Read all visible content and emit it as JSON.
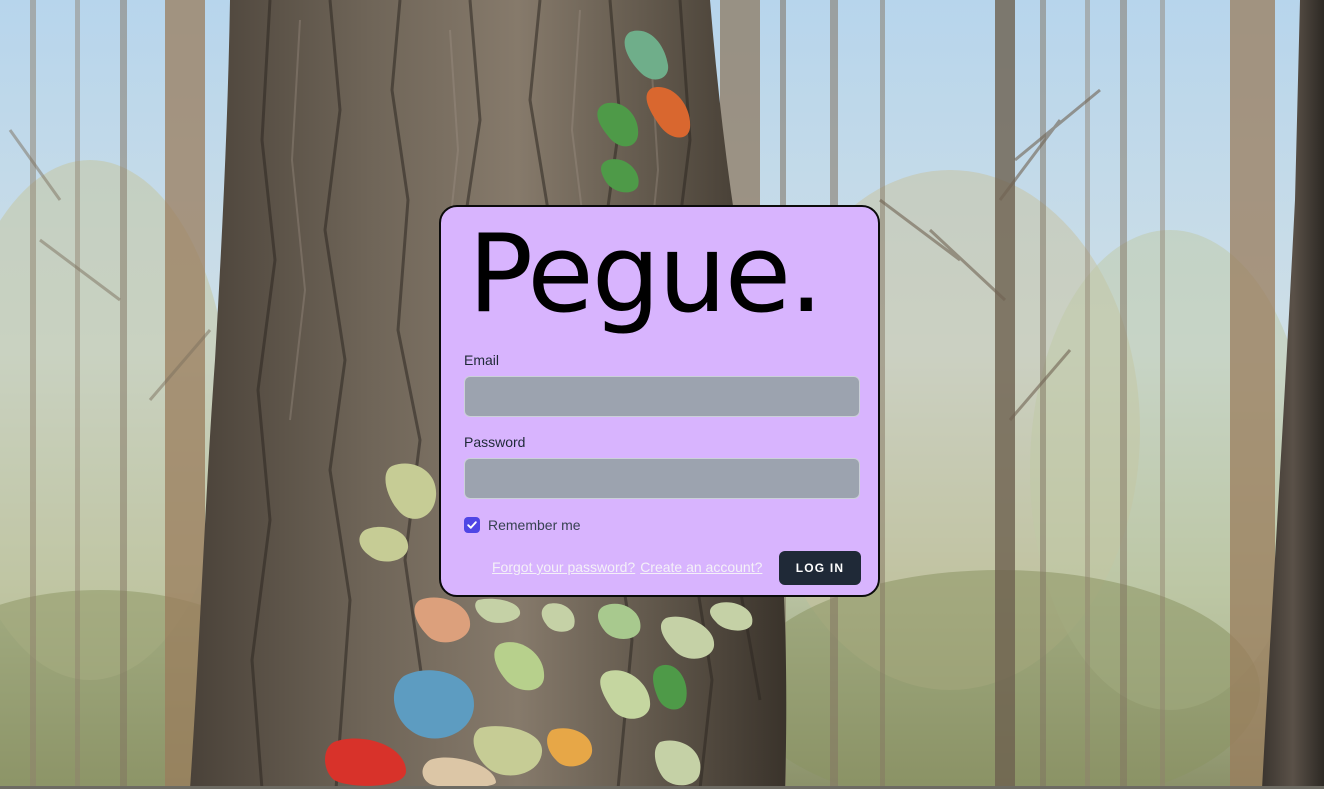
{
  "app": {
    "logo_text": "Pegue."
  },
  "login_form": {
    "email_label": "Email",
    "email_value": "",
    "password_label": "Password",
    "password_value": "",
    "remember_label": "Remember me",
    "remember_checked": true,
    "forgot_link": "Forgot your password?",
    "create_link": "Create an account?",
    "login_button": "LOG IN"
  },
  "colors": {
    "card_background": "#d8b4fe",
    "input_background": "#9ca3af",
    "button_background": "#1f2937",
    "checkbox_accent": "#4f46e5"
  },
  "icons": {
    "checkbox": "check-icon"
  }
}
